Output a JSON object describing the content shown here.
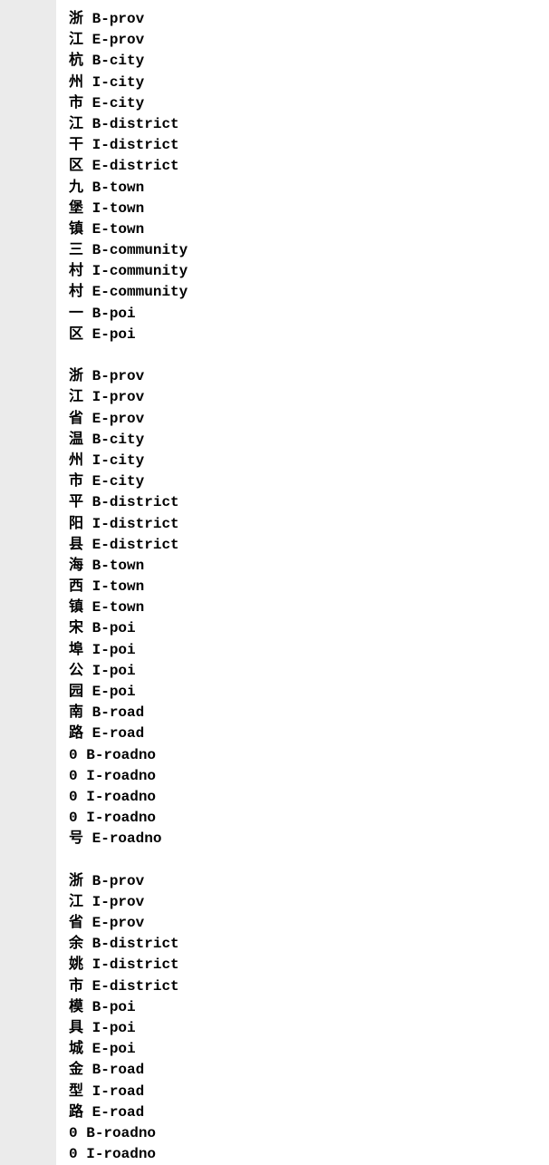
{
  "blocks": [
    {
      "lines": [
        {
          "char": "浙",
          "tag": "B-prov"
        },
        {
          "char": "江",
          "tag": "E-prov"
        },
        {
          "char": "杭",
          "tag": "B-city"
        },
        {
          "char": "州",
          "tag": "I-city"
        },
        {
          "char": "市",
          "tag": "E-city"
        },
        {
          "char": "江",
          "tag": "B-district"
        },
        {
          "char": "干",
          "tag": "I-district"
        },
        {
          "char": "区",
          "tag": "E-district"
        },
        {
          "char": "九",
          "tag": "B-town"
        },
        {
          "char": "堡",
          "tag": "I-town"
        },
        {
          "char": "镇",
          "tag": "E-town"
        },
        {
          "char": "三",
          "tag": "B-community"
        },
        {
          "char": "村",
          "tag": "I-community"
        },
        {
          "char": "村",
          "tag": "E-community"
        },
        {
          "char": "一",
          "tag": "B-poi"
        },
        {
          "char": "区",
          "tag": "E-poi"
        }
      ]
    },
    {
      "lines": [
        {
          "char": "浙",
          "tag": "B-prov"
        },
        {
          "char": "江",
          "tag": "I-prov"
        },
        {
          "char": "省",
          "tag": "E-prov"
        },
        {
          "char": "温",
          "tag": "B-city"
        },
        {
          "char": "州",
          "tag": "I-city"
        },
        {
          "char": "市",
          "tag": "E-city"
        },
        {
          "char": "平",
          "tag": "B-district"
        },
        {
          "char": "阳",
          "tag": "I-district"
        },
        {
          "char": "县",
          "tag": "E-district"
        },
        {
          "char": "海",
          "tag": "B-town"
        },
        {
          "char": "西",
          "tag": "I-town"
        },
        {
          "char": "镇",
          "tag": "E-town"
        },
        {
          "char": "宋",
          "tag": "B-poi"
        },
        {
          "char": "埠",
          "tag": "I-poi"
        },
        {
          "char": "公",
          "tag": "I-poi"
        },
        {
          "char": "园",
          "tag": "E-poi"
        },
        {
          "char": "南",
          "tag": "B-road"
        },
        {
          "char": "路",
          "tag": "E-road"
        },
        {
          "char": "0",
          "tag": "B-roadno"
        },
        {
          "char": "0",
          "tag": "I-roadno"
        },
        {
          "char": "0",
          "tag": "I-roadno"
        },
        {
          "char": "0",
          "tag": "I-roadno"
        },
        {
          "char": "号",
          "tag": "E-roadno"
        }
      ]
    },
    {
      "lines": [
        {
          "char": "浙",
          "tag": "B-prov"
        },
        {
          "char": "江",
          "tag": "I-prov"
        },
        {
          "char": "省",
          "tag": "E-prov"
        },
        {
          "char": "余",
          "tag": "B-district"
        },
        {
          "char": "姚",
          "tag": "I-district"
        },
        {
          "char": "市",
          "tag": "E-district"
        },
        {
          "char": "模",
          "tag": "B-poi"
        },
        {
          "char": "具",
          "tag": "I-poi"
        },
        {
          "char": "城",
          "tag": "E-poi"
        },
        {
          "char": "金",
          "tag": "B-road"
        },
        {
          "char": "型",
          "tag": "I-road"
        },
        {
          "char": "路",
          "tag": "E-road"
        },
        {
          "char": "0",
          "tag": "B-roadno"
        },
        {
          "char": "0",
          "tag": "I-roadno"
        }
      ]
    }
  ]
}
